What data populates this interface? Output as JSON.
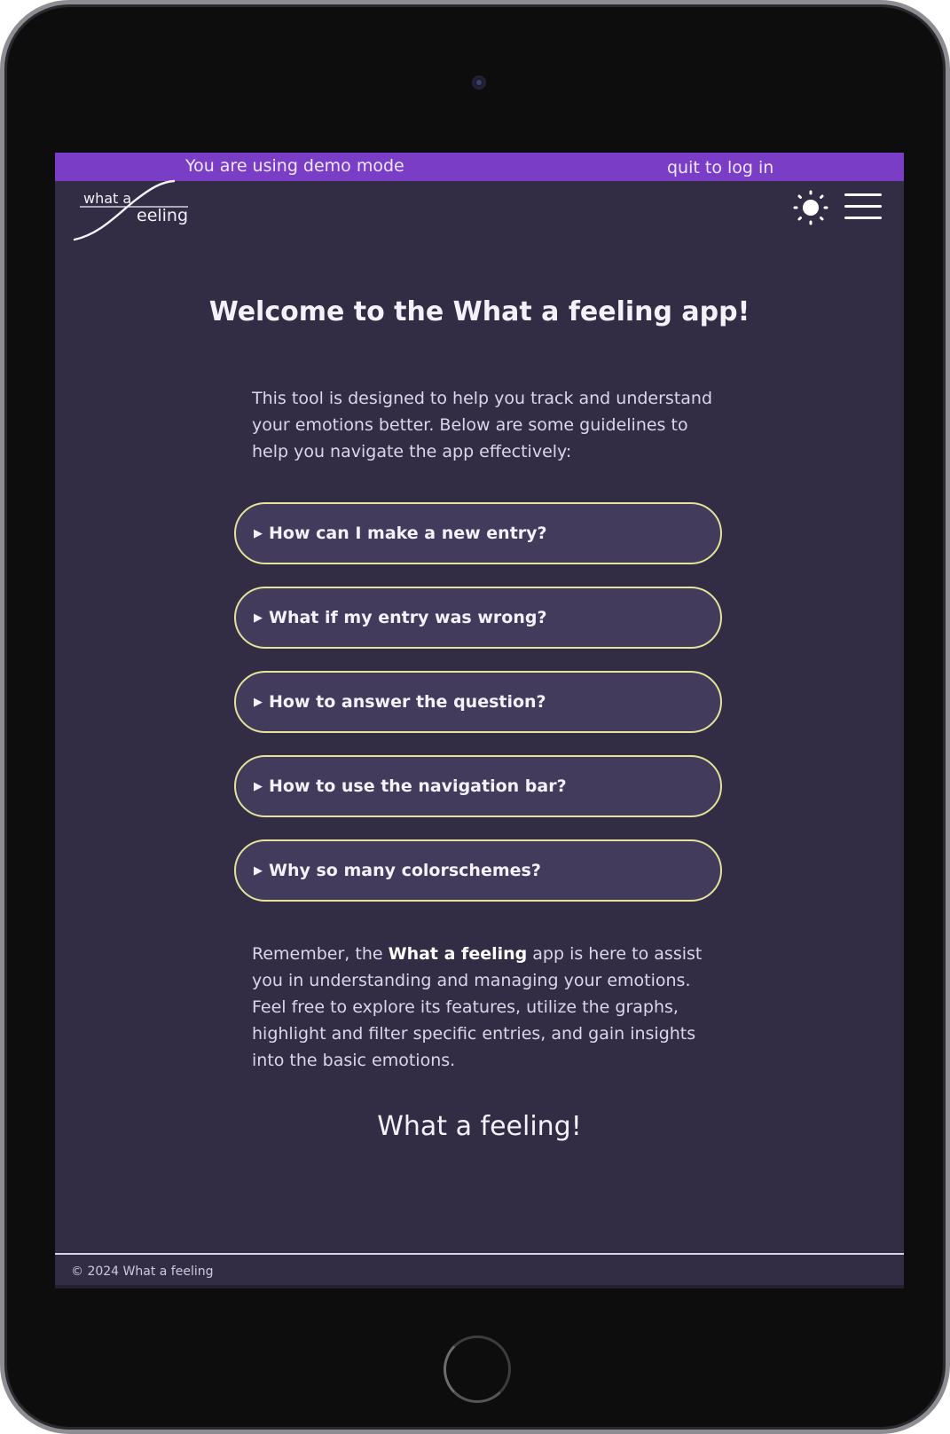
{
  "demo_bar": {
    "message": "You are using demo mode",
    "quit_label": "quit to log in",
    "color": "#7a3ec6"
  },
  "header": {
    "logo_text_top": "what a",
    "logo_text_bottom": "eeling",
    "theme_icon": "sun-icon",
    "menu_icon": "hamburger-menu-icon"
  },
  "main": {
    "title": "Welcome to the What a feeling app!",
    "intro": "This tool is designed to help you track and understand your emotions better. Below are some guidelines to help you navigate the app effectively:",
    "faq": [
      "How can I make a new entry?",
      "What if my entry was wrong?",
      "How to answer the question?",
      "How to use the navigation bar?",
      "Why so many colorschemes?"
    ],
    "faq_marker": "▶",
    "outro_prefix": "Remember, the ",
    "outro_bold": "What a feeling",
    "outro_suffix": " app is here to assist you in understanding and managing your emotions. Feel free to explore its features, utilize the graphs, highlight and filter specific entries, and gain insights into the basic emotions.",
    "signoff": "What a feeling!"
  },
  "footer": {
    "copyright": "© 2024 What a feeling"
  },
  "colors": {
    "background": "#322c45",
    "faq_fill": "#433b5c",
    "faq_border": "#e3e39a"
  }
}
